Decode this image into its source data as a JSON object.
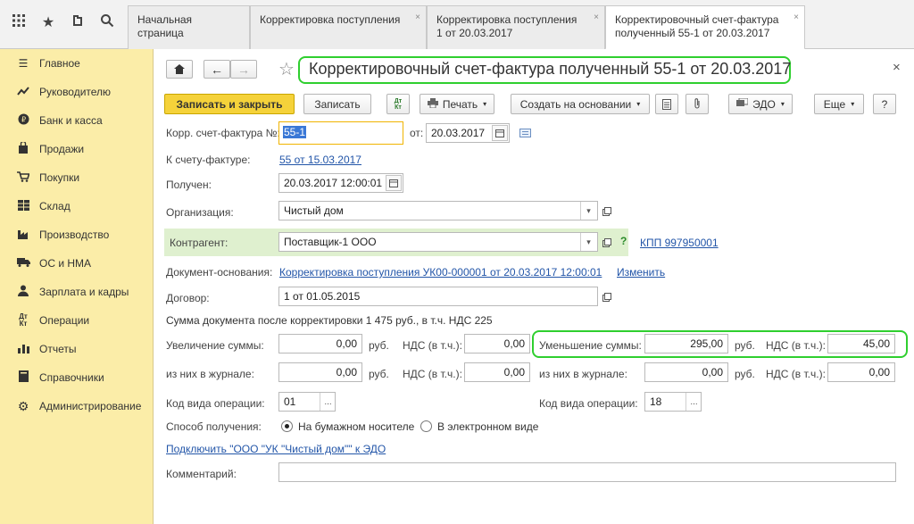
{
  "topbar": {
    "tabs": [
      {
        "label": "Начальная страница"
      },
      {
        "label": "Корректировка поступления"
      },
      {
        "label": "Корректировка поступления 1 от 20.03.2017"
      },
      {
        "label": "Корректировочный счет-фактура полученный 55-1 от 20.03.2017"
      }
    ],
    "close_glyph": "×"
  },
  "sidebar": {
    "items": [
      {
        "label": "Главное",
        "icon": "menu-icon"
      },
      {
        "label": "Руководителю",
        "icon": "trend-icon"
      },
      {
        "label": "Банк и касса",
        "icon": "coin-icon"
      },
      {
        "label": "Продажи",
        "icon": "bag-icon"
      },
      {
        "label": "Покупки",
        "icon": "cart-icon"
      },
      {
        "label": "Склад",
        "icon": "grid-icon"
      },
      {
        "label": "Производство",
        "icon": "factory-icon"
      },
      {
        "label": "ОС и НМА",
        "icon": "truck-icon"
      },
      {
        "label": "Зарплата и кадры",
        "icon": "person-icon"
      },
      {
        "label": "Операции",
        "icon": "dtkt-icon"
      },
      {
        "label": "Отчеты",
        "icon": "barchart-icon"
      },
      {
        "label": "Справочники",
        "icon": "book-icon"
      },
      {
        "label": "Администрирование",
        "icon": "gear-icon"
      }
    ]
  },
  "form": {
    "title": "Корректировочный счет-фактура полученный 55-1 от 20.03.2017",
    "close_glyph": "×",
    "toolbar": {
      "save_close": "Записать и закрыть",
      "save": "Записать",
      "dtkt": "Дт Кт",
      "print": "Печать",
      "create_based": "Создать на основании",
      "edo": "ЭДО",
      "more": "Еще",
      "help": "?"
    },
    "fields": {
      "corr_invoice_label": "Корр. счет-фактура №:",
      "corr_invoice_value": "55-1",
      "from_label": "от:",
      "from_value": "20.03.2017",
      "to_invoice_label": "К счету-фактуре:",
      "to_invoice_link": "55 от 15.03.2017",
      "received_label": "Получен:",
      "received_value": "20.03.2017 12:00:01",
      "org_label": "Организация:",
      "org_value": "Чистый дом",
      "contractor_label": "Контрагент:",
      "contractor_value": "Поставщик-1 ООО",
      "kpp_link": "КПП 997950001",
      "question": "?",
      "base_doc_label": "Документ-основания:",
      "base_doc_link": "Корректировка поступления УК00-000001 от 20.03.2017 12:00:01",
      "change_link": "Изменить",
      "contract_label": "Договор:",
      "contract_value": "1 от 01.05.2015",
      "sum_after": "Сумма документа после корректировки 1 475 руб., в т.ч. НДС 225",
      "increase_label": "Увеличение суммы:",
      "increase_value": "0,00",
      "rub": "руб.",
      "vat_label": "НДС (в т.ч.):",
      "increase_vat_value": "0,00",
      "decrease_label": "Уменьшение суммы:",
      "decrease_value": "295,00",
      "decrease_vat_value": "45,00",
      "journal_label": "из них в журнале:",
      "inc_journal_value": "0,00",
      "inc_journal_vat_value": "0,00",
      "dec_journal_value": "0,00",
      "dec_journal_vat_value": "0,00",
      "op_code_label": "Код вида операции:",
      "op_code_left": "01",
      "op_code_right": "18",
      "receive_method_label": "Способ получения:",
      "radio_paper": "На бумажном носителе",
      "radio_electronic": "В электронном виде",
      "connect_edo_link": "Подключить \"ООО \"УК \"Чистый дом\"\" к ЭДО",
      "comment_label": "Комментарий:",
      "comment_value": ""
    }
  },
  "colors": {
    "sidebar_bg": "#fbeda8",
    "primary_button": "#f5d23a",
    "highlight_border": "#2fcf2f",
    "contractor_row_bg": "#dff0cf",
    "link": "#2255a8"
  }
}
